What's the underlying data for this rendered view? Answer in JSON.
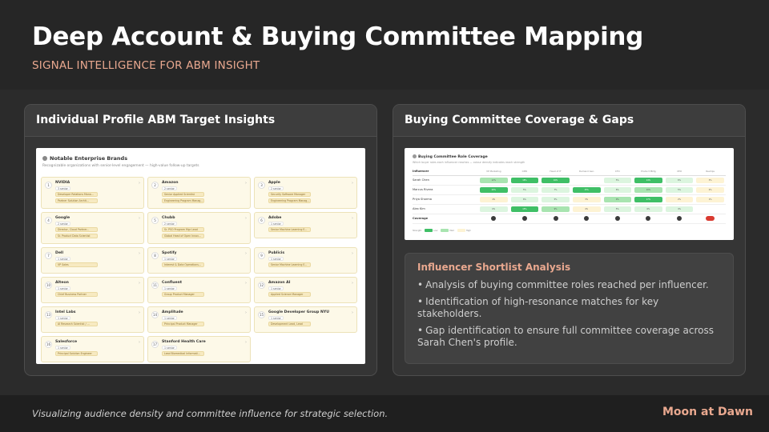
{
  "slide": {
    "title": "Deep Account & Buying Committee Mapping",
    "subtitle": "SIGNAL INTELLIGENCE FOR ABM INSIGHT",
    "footer": "Visualizing audience density and committee influence for strategic selection.",
    "brand": "Moon at Dawn"
  },
  "left_panel": {
    "title": "Individual Profile ABM Target Insights",
    "card_title": "Notable Enterprise Brands",
    "card_subtitle": "Recognizable organizations with senior-level engagement — high-value follow-up targets",
    "brands": [
      {
        "num": "1",
        "name": "NVIDIA",
        "count": "3 senior",
        "tags": [
          "Developer Relations Mana...",
          "Partner Solution Archit..."
        ]
      },
      {
        "num": "2",
        "name": "Amazon",
        "count": "2 senior",
        "tags": [
          "Senior Applied Scientist",
          "Engineering Program Manag..."
        ]
      },
      {
        "num": "3",
        "name": "Apple",
        "count": "2 senior",
        "tags": [
          "Security Software Manager",
          "Engineering Program Manag..."
        ]
      },
      {
        "num": "4",
        "name": "Google",
        "count": "2 senior",
        "tags": [
          "Director, Cloud Partner...",
          "Sr. Product Data Scientist"
        ]
      },
      {
        "num": "5",
        "name": "Chubb",
        "count": "2 senior",
        "tags": [
          "Sr. PSO Program Mgr Lead",
          "Global Head of Open Innov..."
        ]
      },
      {
        "num": "6",
        "name": "Adobe",
        "count": "1 senior",
        "tags": [
          "Senior Machine Learning E..."
        ]
      },
      {
        "num": "7",
        "name": "Dell",
        "count": "1 senior",
        "tags": [
          "VP Sales"
        ]
      },
      {
        "num": "8",
        "name": "Spotify",
        "count": "1 senior",
        "tags": [
          "Interest & Data Operations..."
        ]
      },
      {
        "num": "9",
        "name": "Publicis",
        "count": "1 senior",
        "tags": [
          "Senior Machine Learning E..."
        ]
      },
      {
        "num": "10",
        "name": "Alteon",
        "count": "1 senior",
        "tags": [
          "Chief Business Partner"
        ]
      },
      {
        "num": "11",
        "name": "Confluent",
        "count": "1 senior",
        "tags": [
          "Group Product Manager"
        ]
      },
      {
        "num": "12",
        "name": "Amazon AI",
        "count": "1 senior",
        "tags": [
          "Applied Science Manager"
        ]
      },
      {
        "num": "13",
        "name": "Intel Labs",
        "count": "1 senior",
        "tags": [
          "AI Research Scientist / ..."
        ]
      },
      {
        "num": "14",
        "name": "Amplitude",
        "count": "1 senior",
        "tags": [
          "Principal Product Manager"
        ]
      },
      {
        "num": "15",
        "name": "Google Developer Group NYU",
        "count": "1 senior",
        "tags": [
          "Development Lead, Lead"
        ]
      },
      {
        "num": "16",
        "name": "Salesforce",
        "count": "1 senior",
        "tags": [
          "Principal Solution Engineer"
        ]
      },
      {
        "num": "17",
        "name": "Stanford Health Care",
        "count": "1 senior",
        "tags": [
          "Lead Biomedical Informati..."
        ]
      }
    ]
  },
  "right_panel": {
    "title": "Buying Committee Coverage & Gaps",
    "chart_title": "Buying Committee Role Coverage",
    "chart_subtitle": "Which buyer roles each influencer reaches — colour density indicates reach strength",
    "row_header": "Influencer",
    "columns": [
      "VP Marketing",
      "CMO",
      "Head of IT",
      "Demand Gen",
      "CTO",
      "Product Mktg",
      "CEO",
      "RevOps"
    ],
    "rows": [
      {
        "name": "Sarah Chen",
        "cells": [
          {
            "lvl": 3,
            "t": "12%"
          },
          {
            "lvl": 4,
            "t": "18%"
          },
          {
            "lvl": 4,
            "t": "16%"
          },
          {
            "lvl": 0,
            "t": ""
          },
          {
            "lvl": 2,
            "t": "5%"
          },
          {
            "lvl": 4,
            "t": "14%"
          },
          {
            "lvl": 2,
            "t": "6%"
          },
          {
            "lvl": 1,
            "t": "3%"
          }
        ]
      },
      {
        "name": "Marcus Rivera",
        "cells": [
          {
            "lvl": 4,
            "t": "20%"
          },
          {
            "lvl": 2,
            "t": "5%"
          },
          {
            "lvl": 2,
            "t": "7%"
          },
          {
            "lvl": 4,
            "t": "15%"
          },
          {
            "lvl": 2,
            "t": "6%"
          },
          {
            "lvl": 3,
            "t": "10%"
          },
          {
            "lvl": 2,
            "t": "5%"
          },
          {
            "lvl": 1,
            "t": "2%"
          }
        ]
      },
      {
        "name": "Priya Sharma",
        "cells": [
          {
            "lvl": 1,
            "t": "4%"
          },
          {
            "lvl": 2,
            "t": "6%"
          },
          {
            "lvl": 2,
            "t": "5%"
          },
          {
            "lvl": 1,
            "t": "3%"
          },
          {
            "lvl": 3,
            "t": "9%"
          },
          {
            "lvl": 4,
            "t": "17%"
          },
          {
            "lvl": 1,
            "t": "2%"
          },
          {
            "lvl": 1,
            "t": "1%"
          }
        ]
      },
      {
        "name": "Alex Kim",
        "cells": [
          {
            "lvl": 2,
            "t": "6%"
          },
          {
            "lvl": 4,
            "t": "15%"
          },
          {
            "lvl": 3,
            "t": "9%"
          },
          {
            "lvl": 1,
            "t": "4%"
          },
          {
            "lvl": 2,
            "t": "5%"
          },
          {
            "lvl": 2,
            "t": "6%"
          },
          {
            "lvl": 2,
            "t": "4%"
          },
          {
            "lvl": 0,
            "t": ""
          }
        ]
      }
    ],
    "coverage_label": "Coverage",
    "coverage_gap_index": 7,
    "legend_label": "Strength",
    "legend_items": [
      "Low",
      "Med",
      "High"
    ],
    "analysis_title": "Influencer Shortlist Analysis",
    "analysis_points": [
      "Analysis of buying committee roles reached per influencer.",
      "Identification of high-resonance matches for key stakeholders.",
      "Gap identification to ensure full committee coverage across Sarah Chen's profile."
    ],
    "bullet": "•"
  }
}
